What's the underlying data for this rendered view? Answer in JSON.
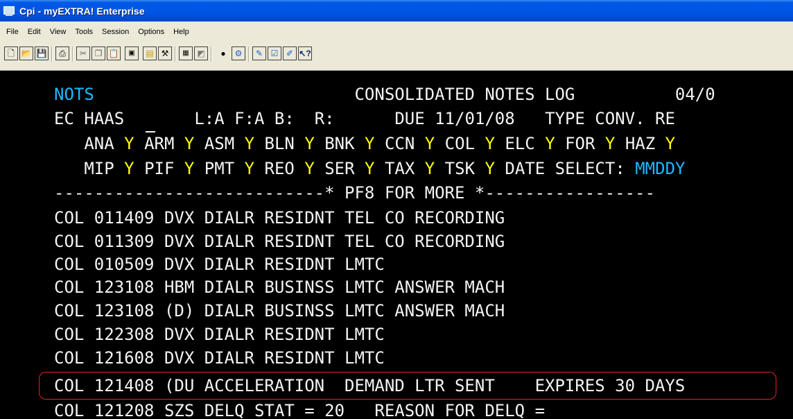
{
  "window": {
    "title": "Cpi - myEXTRA! Enterprise"
  },
  "menu": [
    "File",
    "Edit",
    "View",
    "Tools",
    "Session",
    "Options",
    "Help"
  ],
  "toolbar_icons": [
    "new-file-icon",
    "open-folder-icon",
    "save-icon",
    "print-icon",
    "cut-icon",
    "copy-icon",
    "paste-icon",
    "capture-icon",
    "open-session-icon",
    "tools-icon",
    "macro-icon",
    "session-icon",
    "record-icon",
    "settings-icon",
    "edit-icon",
    "properties-icon",
    "quickpad-icon",
    "help-icon"
  ],
  "terminal": {
    "row1": {
      "screen_id": "NOTS",
      "title": "CONSOLIDATED NOTES LOG",
      "date": "04/0"
    },
    "row2": {
      "name": "EC HAAS",
      "codes": "L:A F:A B:  R:",
      "due": "DUE 11/01/08",
      "type": "TYPE CONV. RE"
    },
    "filters1": [
      {
        "code": "ANA",
        "v": "Y"
      },
      {
        "code": "ARM",
        "v": "Y"
      },
      {
        "code": "ASM",
        "v": "Y"
      },
      {
        "code": "BLN",
        "v": "Y"
      },
      {
        "code": "BNK",
        "v": "Y"
      },
      {
        "code": "CCN",
        "v": "Y"
      },
      {
        "code": "COL",
        "v": "Y"
      },
      {
        "code": "ELC",
        "v": "Y"
      },
      {
        "code": "FOR",
        "v": "Y"
      },
      {
        "code": "HAZ",
        "v": "Y"
      }
    ],
    "filters2": [
      {
        "code": "MIP",
        "v": "Y"
      },
      {
        "code": "PIF",
        "v": "Y"
      },
      {
        "code": "PMT",
        "v": "Y"
      },
      {
        "code": "REO",
        "v": "Y"
      },
      {
        "code": "SER",
        "v": "Y"
      },
      {
        "code": "TAX",
        "v": "Y"
      },
      {
        "code": "TSK",
        "v": "Y"
      }
    ],
    "date_select_label": "DATE SELECT:",
    "date_select_value": "MMDDY",
    "separator": "---------------------------* PF8 FOR MORE *-----------------",
    "notes": [
      "COL 011409 DVX DIALR RESIDNT TEL CO RECORDING",
      "COL 011309 DVX DIALR RESIDNT TEL CO RECORDING",
      "COL 010509 DVX DIALR RESIDNT LMTC",
      "COL 123108 HBM DIALR BUSINSS LMTC ANSWER MACH",
      "COL 123108 (D) DIALR BUSINSS LMTC ANSWER MACH",
      "COL 122308 DVX DIALR RESIDNT LMTC",
      "COL 121608 DVX DIALR RESIDNT LMTC",
      "COL 121408 (DU ACCELERATION  DEMAND LTR SENT    EXPIRES 30 DAYS",
      "COL 121208 SZS DELQ STAT = 20   REASON FOR DELQ ="
    ],
    "highlight_color": "#e0242a",
    "colors": {
      "field_label": "#1fb8ff",
      "field_value": "#ffff00",
      "text": "#f4f4f4",
      "background": "#000000"
    }
  }
}
